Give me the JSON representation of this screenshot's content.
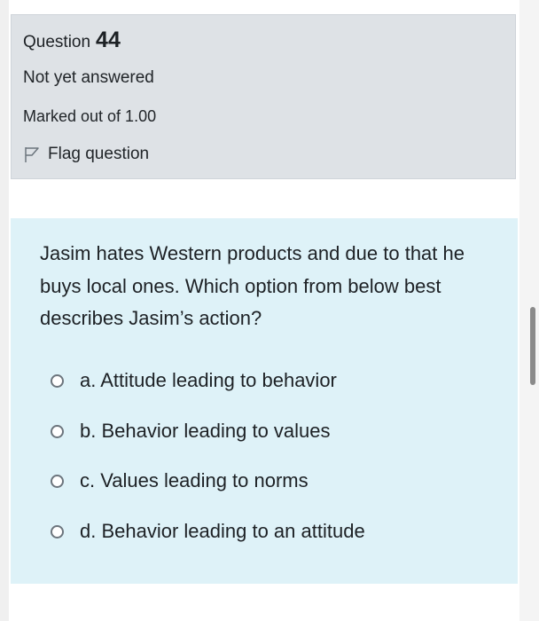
{
  "question_info": {
    "label": "Question",
    "number": "44",
    "state": "Not yet answered",
    "grade": "Marked out of 1.00",
    "flag_label": "Flag question"
  },
  "question": {
    "text": "Jasim hates Western products and due to that he buys local ones. Which option from below best describes Jasim’s action?",
    "answers": [
      {
        "label": "a. Attitude leading to behavior"
      },
      {
        "label": "b. Behavior leading to values"
      },
      {
        "label": "c. Values leading to norms"
      },
      {
        "label": "d. Behavior leading to an attitude"
      }
    ]
  },
  "icons": {
    "flag": "flag-icon",
    "radio": "radio-unchecked-icon"
  },
  "colors": {
    "info_background": "#dee2e6",
    "question_background": "#def2f8",
    "text": "#1d2125"
  }
}
